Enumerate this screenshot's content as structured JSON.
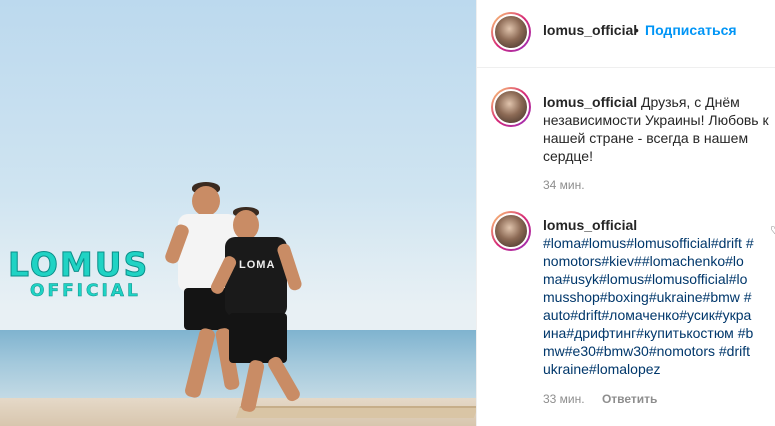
{
  "post": {
    "image": {
      "logo_line1": "LOMUS",
      "logo_line2": "OFFICIAL",
      "shirt_text": "LOMA"
    }
  },
  "header": {
    "username": "lomus_official",
    "separator": "•",
    "follow_label": "Подписаться"
  },
  "comments": [
    {
      "username": "lomus_official",
      "text": "Друзья, с Днём независимости Украины! Любовь к нашей стране - всегда в нашем сердце!",
      "time": "34 мин."
    },
    {
      "username": "lomus_official",
      "text": "#loma#lomus#lomusofficial#drift #nomotors#kiev##lomachenko#loma#usyk#lomus#lomusofficial#lomusshop#boxing#ukraine#bmw #auto#drift#ломаченко#усик#украина#дрифтинг#купитькостюм #bmw#e30#bmw30#nomotors #driftukraine#lomalopez",
      "time": "33 мин.",
      "reply_label": "Ответить"
    }
  ],
  "icons": {
    "like": "heart-icon"
  }
}
